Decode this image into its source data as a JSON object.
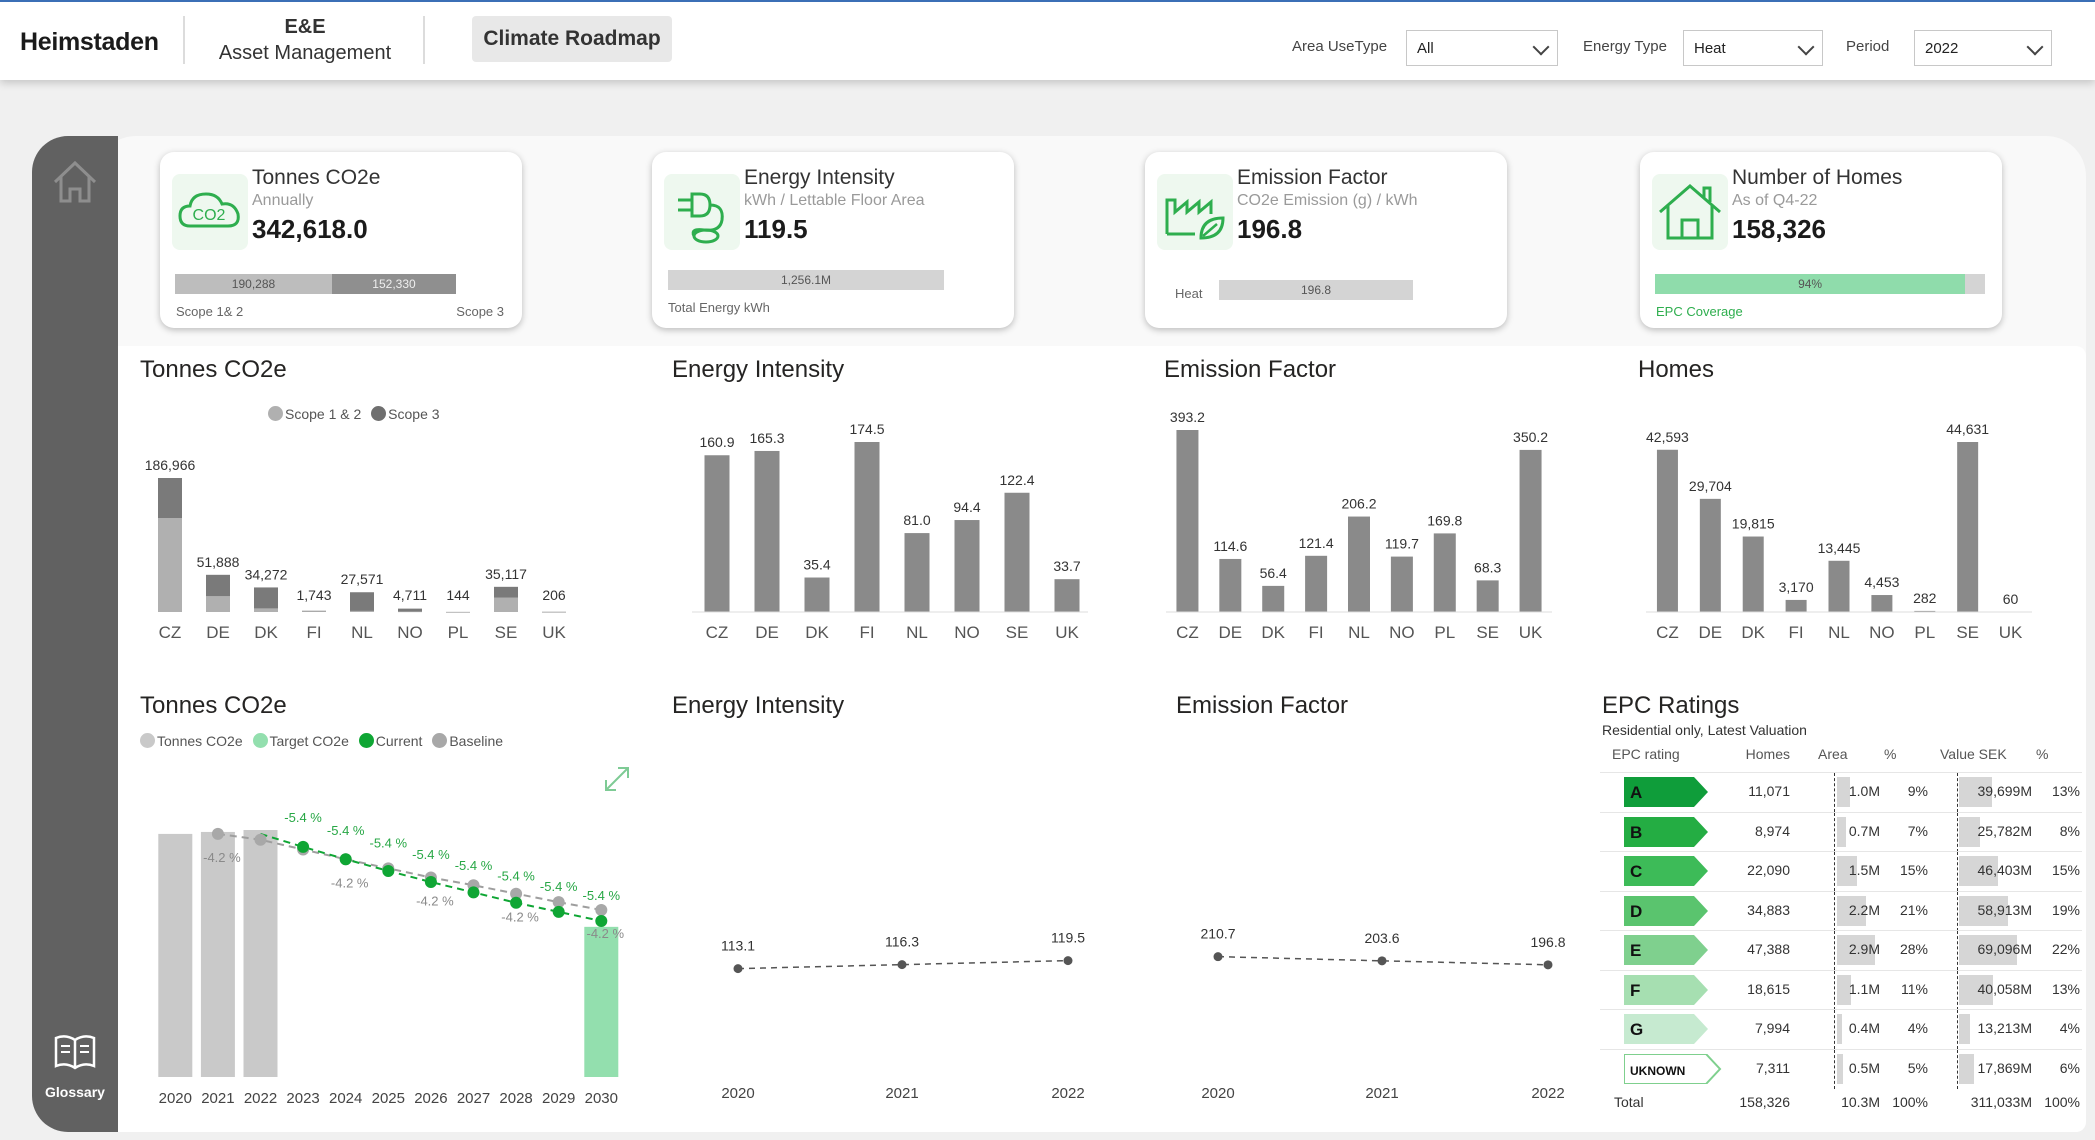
{
  "header": {
    "brand": "Heimstaden",
    "section_line1": "E&E",
    "section_line2": "Asset Management",
    "active_tab": "Climate Roadmap",
    "filters": [
      {
        "label": "Area UseType",
        "value": "All"
      },
      {
        "label": "Energy Type",
        "value": "Heat"
      },
      {
        "label": "Period",
        "value": "2022"
      }
    ]
  },
  "sidebar": {
    "home_icon": "home-icon",
    "glossary_icon": "book-icon",
    "glossary_label": "Glossary"
  },
  "kpis": {
    "co2": {
      "title": "Tonnes CO2e",
      "sub": "Annually",
      "value": "342,618.0",
      "bar_left": "190,288",
      "bar_right": "152,330",
      "foot_left": "Scope 1& 2",
      "foot_right": "Scope 3",
      "icon": "co2-cloud-icon"
    },
    "energy": {
      "title": "Energy Intensity",
      "sub": "kWh / Lettable Floor Area",
      "value": "119.5",
      "bar": "1,256.1M",
      "foot": "Total Energy kWh",
      "icon": "plug-icon"
    },
    "emission": {
      "title": "Emission Factor",
      "sub": "CO2e Emission (g) / kWh",
      "value": "196.8",
      "bar_label": "Heat",
      "bar": "196.8",
      "icon": "factory-icon"
    },
    "homes": {
      "title": "Number of Homes",
      "sub": "As of Q4-22",
      "value": "158,326",
      "bar": "94%",
      "bar_fraction": 0.94,
      "foot": "EPC Coverage",
      "icon": "house-icon"
    }
  },
  "sections": {
    "co2_country": "Tonnes CO2e",
    "energy_country": "Energy Intensity",
    "emission_country": "Emission Factor",
    "homes_country": "Homes",
    "co2_roadmap": "Tonnes CO2e",
    "energy_trend": "Energy Intensity",
    "emission_trend": "Emission Factor",
    "epc": "EPC Ratings",
    "epc_sub": "Residential only, Latest Valuation"
  },
  "legends": {
    "co2_country": [
      "Scope 1 & 2",
      "Scope 3"
    ],
    "co2_roadmap": [
      "Tonnes CO2e",
      "Target CO2e",
      "Current",
      "Baseline"
    ]
  },
  "colors": {
    "bar_gray": "#8a8a8a",
    "scope12": "#b0b0b0",
    "scope3": "#7a7a7a",
    "green": "#0fa634",
    "light_green": "#93dfae",
    "roadmap_bar": "#c9c9c9"
  },
  "chart_data": [
    {
      "type": "bar",
      "title": "Tonnes CO2e",
      "categories": [
        "CZ",
        "DE",
        "DK",
        "FI",
        "NL",
        "NO",
        "PL",
        "SE",
        "UK"
      ],
      "series": [
        {
          "name": "Scope 1 & 2",
          "values": [
            131000,
            22000,
            5000,
            1000,
            1500,
            500,
            0,
            20000,
            206
          ]
        },
        {
          "name": "Scope 3",
          "values": [
            55966,
            29888,
            29272,
            743,
            26071,
            4211,
            144,
            15117,
            0
          ]
        }
      ],
      "labels": [
        "186,966",
        "51,888",
        "34,272",
        "1,743",
        "27,571",
        "4,711",
        "144",
        "35,117",
        "206"
      ],
      "totals": [
        186966,
        51888,
        34272,
        1743,
        27571,
        4711,
        144,
        35117,
        206
      ]
    },
    {
      "type": "bar",
      "title": "Energy Intensity",
      "categories": [
        "CZ",
        "DE",
        "DK",
        "FI",
        "NL",
        "NO",
        "SE",
        "UK"
      ],
      "values": [
        160.9,
        165.3,
        35.4,
        174.5,
        81.0,
        94.4,
        122.4,
        33.7
      ],
      "labels": [
        "160.9",
        "165.3",
        "35.4",
        "174.5",
        "81.0",
        "94.4",
        "122.4",
        "33.7"
      ]
    },
    {
      "type": "bar",
      "title": "Emission Factor",
      "categories": [
        "CZ",
        "DE",
        "DK",
        "FI",
        "NL",
        "NO",
        "PL",
        "SE",
        "UK"
      ],
      "values": [
        393.2,
        114.6,
        56.4,
        121.4,
        206.2,
        119.7,
        169.8,
        68.3,
        350.2
      ],
      "labels": [
        "393.2",
        "114.6",
        "56.4",
        "121.4",
        "206.2",
        "119.7",
        "169.8",
        "68.3",
        "350.2"
      ]
    },
    {
      "type": "bar",
      "title": "Homes",
      "categories": [
        "CZ",
        "DE",
        "DK",
        "FI",
        "NL",
        "NO",
        "PL",
        "SE",
        "UK"
      ],
      "values": [
        42593,
        29704,
        19815,
        3170,
        13445,
        4453,
        282,
        44631,
        60
      ],
      "labels": [
        "42,593",
        "29,704",
        "19,815",
        "3,170",
        "13,445",
        "4,453",
        "282",
        "44,631",
        "60"
      ]
    },
    {
      "type": "bar",
      "title": "Tonnes CO2e",
      "categories": [
        "2020",
        "2021",
        "2022",
        "2023",
        "2024",
        "2025",
        "2026",
        "2027",
        "2028",
        "2029",
        "2030"
      ],
      "bars": [
        374000,
        377000,
        380000,
        0,
        0,
        0,
        0,
        0,
        0,
        0,
        231000
      ],
      "target": [
        null,
        null,
        374000,
        354000,
        335000,
        317000,
        300000,
        284000,
        268000,
        254000,
        240000
      ],
      "baseline": [
        null,
        374000,
        365000,
        350000,
        335000,
        321000,
        307000,
        295000,
        282000,
        269000,
        257000
      ],
      "target_labels": [
        "-5.4 %",
        "-5.4 %",
        "-5.4 %",
        "-5.4 %",
        "-5.4 %",
        "-5.4 %",
        "-5.4 %",
        "-5.4 %"
      ],
      "baseline_labels": [
        "-4.2 %",
        "-4.2 %",
        "-4.2 %",
        "-4.2 %",
        "-4.2 %"
      ]
    },
    {
      "type": "line",
      "title": "Energy Intensity",
      "categories": [
        "2020",
        "2021",
        "2022"
      ],
      "values": [
        113.1,
        116.3,
        119.5
      ],
      "labels": [
        "113.1",
        "116.3",
        "119.5"
      ]
    },
    {
      "type": "line",
      "title": "Emission Factor",
      "categories": [
        "2020",
        "2021",
        "2022"
      ],
      "values": [
        210.7,
        203.6,
        196.8
      ],
      "labels": [
        "210.7",
        "203.6",
        "196.8"
      ]
    },
    {
      "type": "table",
      "title": "EPC Ratings",
      "columns": [
        "EPC rating",
        "Homes",
        "Area",
        "%",
        "Value SEK",
        "%"
      ],
      "rows": [
        {
          "rating": "A",
          "homes": "11,071",
          "area": "1.0M",
          "area_pct": "9%",
          "value": "39,699M",
          "value_pct": "13%",
          "color": "#0f9d3a",
          "area_frac": 0.34,
          "value_frac": 0.57
        },
        {
          "rating": "B",
          "homes": "8,974",
          "area": "0.7M",
          "area_pct": "7%",
          "value": "25,782M",
          "value_pct": "8%",
          "color": "#24ad43",
          "area_frac": 0.24,
          "value_frac": 0.37
        },
        {
          "rating": "C",
          "homes": "22,090",
          "area": "1.5M",
          "area_pct": "15%",
          "value": "46,403M",
          "value_pct": "15%",
          "color": "#3dbb58",
          "area_frac": 0.52,
          "value_frac": 0.67
        },
        {
          "rating": "D",
          "homes": "34,883",
          "area": "2.2M",
          "area_pct": "21%",
          "value": "58,913M",
          "value_pct": "19%",
          "color": "#5ac46e",
          "area_frac": 0.76,
          "value_frac": 0.85
        },
        {
          "rating": "E",
          "homes": "47,388",
          "area": "2.9M",
          "area_pct": "28%",
          "value": "69,096M",
          "value_pct": "22%",
          "color": "#7fd08e",
          "area_frac": 1.0,
          "value_frac": 1.0
        },
        {
          "rating": "F",
          "homes": "18,615",
          "area": "1.1M",
          "area_pct": "11%",
          "value": "40,058M",
          "value_pct": "13%",
          "color": "#a6dfb1",
          "area_frac": 0.38,
          "value_frac": 0.58
        },
        {
          "rating": "G",
          "homes": "7,994",
          "area": "0.4M",
          "area_pct": "4%",
          "value": "13,213M",
          "value_pct": "4%",
          "color": "#c6ead0",
          "area_frac": 0.14,
          "value_frac": 0.19
        },
        {
          "rating": "UKNOWN",
          "homes": "7,311",
          "area": "0.5M",
          "area_pct": "5%",
          "value": "17,869M",
          "value_pct": "6%",
          "color": "#dff4e5",
          "area_frac": 0.17,
          "value_frac": 0.26
        }
      ],
      "total": {
        "label": "Total",
        "homes": "158,326",
        "area": "10.3M",
        "area_pct": "100%",
        "value": "311,033M",
        "value_pct": "100%"
      }
    }
  ]
}
